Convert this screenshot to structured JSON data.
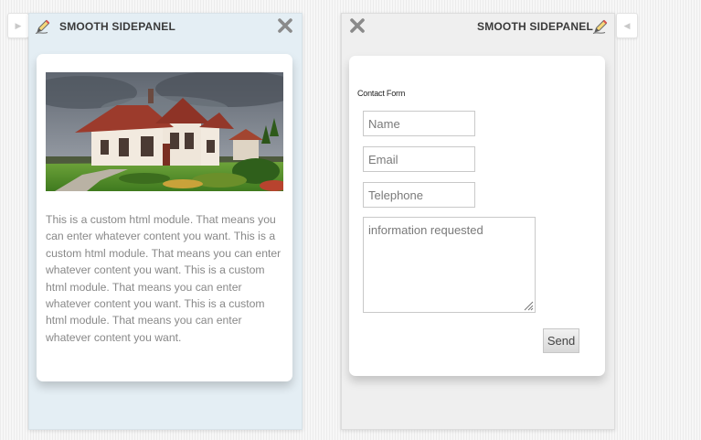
{
  "panel_left": {
    "title": "SMOOTH SIDEPANEL",
    "body_text": "This is a custom html module. That means you can enter whatever content you want. This is a custom html module. That means you can enter whatever content you want. This is a custom html module. That means you can enter whatever content you want. This is a custom html module. That means you can enter whatever content you want."
  },
  "panel_right": {
    "title": "SMOOTH SIDEPANEL",
    "form": {
      "title": "Contact Form",
      "name_placeholder": "Name",
      "email_placeholder": "Email",
      "telephone_placeholder": "Telephone",
      "message_placeholder": "information requested",
      "send_label": "Send"
    }
  },
  "icons": {
    "tab_left": "triangle-right-icon",
    "tab_right": "triangle-left-icon",
    "edit": "pencil-icon",
    "close": "close-icon"
  }
}
